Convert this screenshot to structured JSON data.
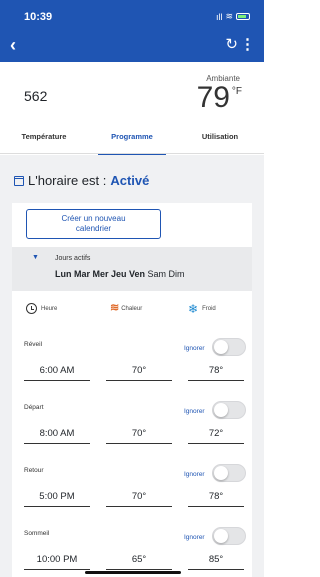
{
  "status": {
    "time": "10:39",
    "signal": "ıll",
    "wifi": "≋"
  },
  "appbar": {
    "back_glyph": "‹",
    "refresh_glyph": "↻",
    "menu_glyph": "⋮"
  },
  "device": {
    "name": "562",
    "ambient_label": "Ambiante",
    "ambient_temp": "79",
    "ambient_unit": "°F"
  },
  "tabs": [
    {
      "label": "Température",
      "active": false
    },
    {
      "label": "Programme",
      "active": true
    },
    {
      "label": "Utilisation",
      "active": false
    }
  ],
  "schedule": {
    "prefix": "L'horaire est : ",
    "state": "Activé",
    "create_button": "Créer un nouveau calendrier",
    "active_days_label": "Jours actifs",
    "days_selected": "Lun Mar Mer Jeu Ven",
    "days_other": " Sam Dim"
  },
  "legend": {
    "time": "Heure",
    "heat": "Chaleur",
    "cool": "Froid"
  },
  "periods": [
    {
      "name": "Réveil",
      "ignore": "Ignorer",
      "time": "6:00 AM",
      "heat": "70°",
      "cool": "78°"
    },
    {
      "name": "Départ",
      "ignore": "Ignorer",
      "time": "8:00 AM",
      "heat": "70°",
      "cool": "72°"
    },
    {
      "name": "Retour",
      "ignore": "Ignorer",
      "time": "5:00 PM",
      "heat": "70°",
      "cool": "78°"
    },
    {
      "name": "Sommeil",
      "ignore": "Ignorer",
      "time": "10:00 PM",
      "heat": "65°",
      "cool": "85°"
    }
  ],
  "colors": {
    "brand": "#1f55b3",
    "heat": "#e06b2b",
    "cool": "#1f8ad1"
  },
  "icons": [
    "back-icon",
    "refresh-icon",
    "more-icon",
    "calendar-icon",
    "clock-icon",
    "heat-icon",
    "snowflake-icon"
  ]
}
